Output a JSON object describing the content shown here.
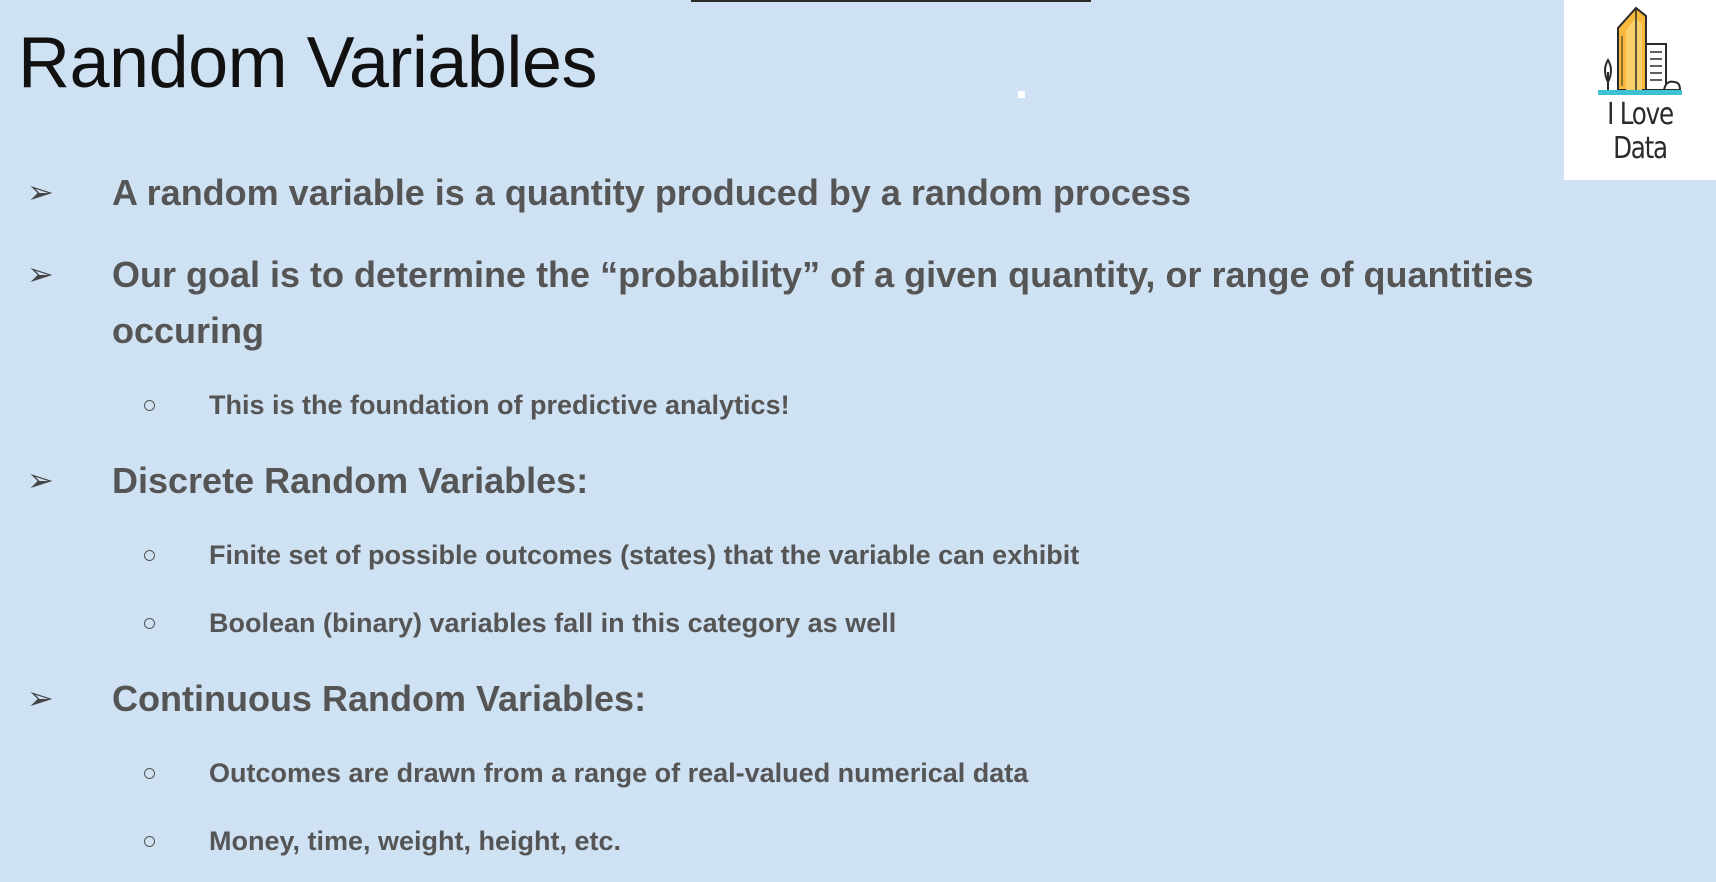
{
  "slide": {
    "title": "Random Variables"
  },
  "logo": {
    "line1": "I Love",
    "line2": "Data"
  },
  "bullets": [
    {
      "text": "A random variable is a quantity produced by a random process",
      "sub": []
    },
    {
      "text_line1": "Our goal is to determine the “probability” of a given quantity, or range of quantities",
      "text_line2": "occuring",
      "sub": [
        "This is the foundation of predictive analytics!"
      ]
    },
    {
      "text": "Discrete Random Variables:",
      "sub": [
        "Finite set of possible outcomes (states) that the variable can exhibit",
        "Boolean (binary) variables fall in this category as well"
      ]
    },
    {
      "text": "Continuous Random Variables:",
      "sub": [
        "Outcomes are drawn from a range of real-valued numerical data",
        "Money, time, weight, height, etc."
      ]
    }
  ],
  "icons": {
    "bullet_marker": "arrowhead-icon",
    "sub_bullet_marker": "hollow-circle-icon",
    "logo": "city-buildings-icon"
  },
  "colors": {
    "background": "#cfe2f3",
    "title": "#111111",
    "body_text": "#555555",
    "logo_building": "#f6b93b",
    "logo_ground": "#3ec1d3"
  }
}
